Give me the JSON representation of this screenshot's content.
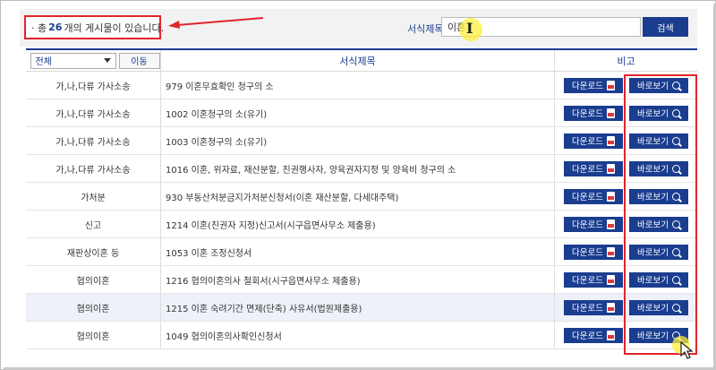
{
  "summary": {
    "prefix": "· 총",
    "count": "26",
    "suffix": "개의 게시물이 있습니다."
  },
  "search": {
    "label": "서식제목",
    "value": "이혼",
    "button": "검색"
  },
  "filter": {
    "category_selected": "전체",
    "move_button": "이동"
  },
  "table": {
    "headers": {
      "title": "서식제목",
      "note": "비고"
    },
    "rows": [
      {
        "category": "가,나,다류 가사소송",
        "title": "979 이혼무효확인 청구의 소"
      },
      {
        "category": "가,나,다류 가사소송",
        "title": "1002 이혼청구의 소(유기)"
      },
      {
        "category": "가,나,다류 가사소송",
        "title": "1003 이혼청구의 소(유기)"
      },
      {
        "category": "가,나,다류 가사소송",
        "title": "1016 이혼, 위자료, 재산분할, 친권행사자, 양육권자지정 및 양육비 청구의 소"
      },
      {
        "category": "가처분",
        "title": "930 부동산처분금지가처분신청서(이혼 재산분할, 다세대주택)"
      },
      {
        "category": "신고",
        "title": "1214 이혼(친권자 지정)신고서(시구읍면사무소 제출용)"
      },
      {
        "category": "재판상이혼 등",
        "title": "1053 이혼 조정신청서"
      },
      {
        "category": "협의이혼",
        "title": "1216 협의이혼의사 철회서(시구읍면사무소 제출용)"
      },
      {
        "category": "협의이혼",
        "title": "1215 이혼 숙려기간 면제(단축) 사유서(법원제출용)"
      },
      {
        "category": "협의이혼",
        "title": "1049 협의이혼의사확인신청서"
      }
    ],
    "download_label": "다운로드",
    "view_label": "바로보기"
  },
  "colors": {
    "accent": "#1a3d8f",
    "highlight": "#e0252b",
    "cursor": "#ffee3c"
  }
}
